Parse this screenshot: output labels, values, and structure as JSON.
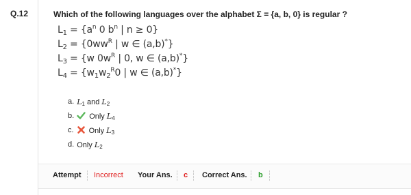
{
  "question": {
    "number": "Q.12",
    "text": "Which of the following languages over the alphabet Σ = {a, b, 0} is regular ?"
  },
  "languages": [
    {
      "name": "L",
      "sub": "1",
      "def_parts": [
        "= {a",
        "n",
        " 0 b",
        "n",
        " | n ≥ 0}"
      ]
    },
    {
      "name": "L",
      "sub": "2",
      "def_parts": [
        "= {0ww",
        "R",
        " | w ∈ (a,b)",
        "*",
        "}"
      ]
    },
    {
      "name": "L",
      "sub": "3",
      "def_parts": [
        "= {w 0w",
        "R",
        " | 0, w ∈ (a,b)",
        "*",
        "}"
      ]
    },
    {
      "name": "L",
      "sub": "4",
      "def_parts": [
        "= {w",
        "1",
        "w",
        "2",
        "R",
        "0 | w ∈ (a,b)",
        "*",
        "}"
      ]
    }
  ],
  "options": [
    {
      "letter": "a.",
      "mark": "",
      "parts": [
        "L",
        "1",
        " and ",
        "L",
        "2"
      ]
    },
    {
      "letter": "b.",
      "mark": "check",
      "parts": [
        "Only ",
        "L",
        "4"
      ]
    },
    {
      "letter": "c.",
      "mark": "cross",
      "parts": [
        "Only ",
        "L",
        "3"
      ]
    },
    {
      "letter": "d.",
      "mark": "",
      "parts": [
        "Only ",
        "L",
        "2"
      ]
    }
  ],
  "result": {
    "attempt_label": "Attempt",
    "attempt_value": "Incorrect",
    "your_ans_label": "Your Ans.",
    "your_ans_value": "c",
    "correct_ans_label": "Correct Ans.",
    "correct_ans_value": "b"
  },
  "colors": {
    "incorrect": "#e02020",
    "correct_value": "#2a9d2a",
    "check": "#5cb85c",
    "cross": "#e8553a"
  }
}
